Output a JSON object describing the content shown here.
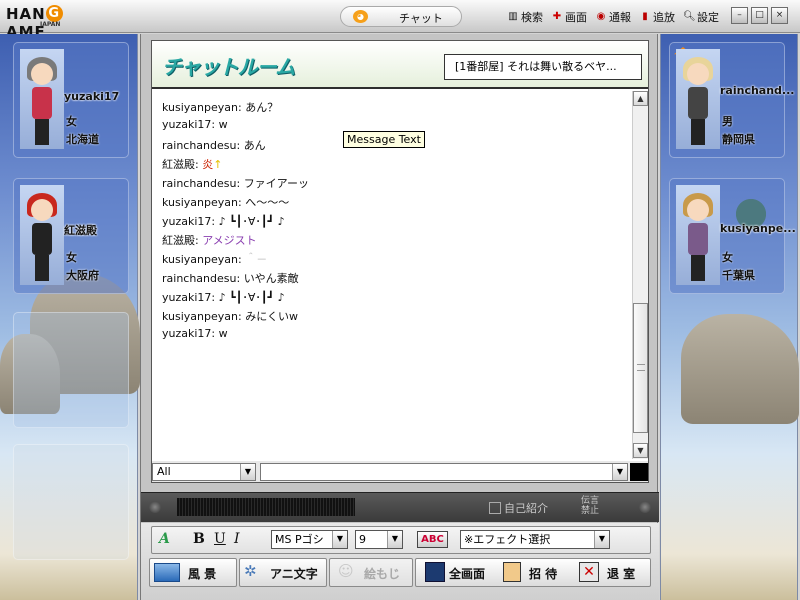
{
  "topbar": {
    "logo_text_left": "HAN",
    "logo_g": "G",
    "logo_text_right": "AME",
    "logo_sub": "JAPAN",
    "active_tab": "チャット",
    "menu": [
      {
        "label": "検索",
        "icon": "bars-icon"
      },
      {
        "label": "画面",
        "icon": "screen-icon"
      },
      {
        "label": "通報",
        "icon": "report-icon"
      },
      {
        "label": "追放",
        "icon": "kick-icon"
      },
      {
        "label": "設定",
        "icon": "settings-icon"
      }
    ],
    "window_buttons": [
      "–",
      "□",
      "×"
    ]
  },
  "chat": {
    "room_title": "チャットルーム",
    "room_name": "[1番部屋] それは舞い散るベヤ...",
    "tooltip": "Message Text",
    "messages": [
      {
        "user": "kusiyanpeyan",
        "text": "あん？"
      },
      {
        "user": "yuzaki17",
        "text": "w"
      },
      {
        "user": "rainchandesu",
        "text": "あん"
      },
      {
        "user": "紅滋殿",
        "text": "炎",
        "color": "#cc2200",
        "suffix": "↑",
        "suffix_color": "#e8c000"
      },
      {
        "user": "rainchandesu",
        "text": "ファイアーッ"
      },
      {
        "user": "kusiyanpeyan",
        "text": "へ～～～"
      },
      {
        "user": "yuzaki17",
        "text": "♪ ┗┃･∀･┃┛ ♪"
      },
      {
        "user": "紅滋殿",
        "text": "アメジスト",
        "color": "#8a3fb0"
      },
      {
        "user": "kusiyanpeyan",
        "text": "＾－",
        "color": "#bbbbbb"
      },
      {
        "user": "rainchandesu",
        "text": "いやん素敵"
      },
      {
        "user": "yuzaki17",
        "text": "♪ ┗┃･∀･┃┛ ♪"
      },
      {
        "user": "kusiyanpeyan",
        "text": "みにくいw"
      },
      {
        "user": "yuzaki17",
        "text": "w"
      }
    ],
    "target_select": "All",
    "input_value": ""
  },
  "darkbar": {
    "profile_label": "自己紹介",
    "ban_label_line1": "伝言",
    "ban_label_line2": "禁止"
  },
  "tools": {
    "font_name": "MS Pゴシ",
    "font_size": "9",
    "abc_label": "ABC",
    "bold": "B",
    "underline": "U",
    "italic": "I",
    "effect_select": "※エフェクト選択",
    "scenery": "風 景",
    "anime_text": "アニ文字",
    "emoji_text": "絵もじ",
    "fullscreen": "全画面",
    "invite": "招 待",
    "exit": "退 室"
  },
  "users": [
    {
      "name": "yuzaki17",
      "gender": "女",
      "pref": "北海道",
      "side": "left",
      "hair": "#7a7a7a",
      "outfit": "#c8324a"
    },
    {
      "name": "紅滋殿",
      "gender": "女",
      "pref": "大阪府",
      "side": "left",
      "hair": "#c8281e",
      "outfit": "#222222"
    },
    {
      "name": "rainchand...",
      "gender": "男",
      "pref": "静岡県",
      "side": "right",
      "hair": "#e8d49a",
      "outfit": "#444444"
    },
    {
      "name": "kusiyanpe...",
      "gender": "女",
      "pref": "千葉県",
      "side": "right",
      "hair": "#c89a4a",
      "outfit": "#7a5a8a"
    }
  ]
}
